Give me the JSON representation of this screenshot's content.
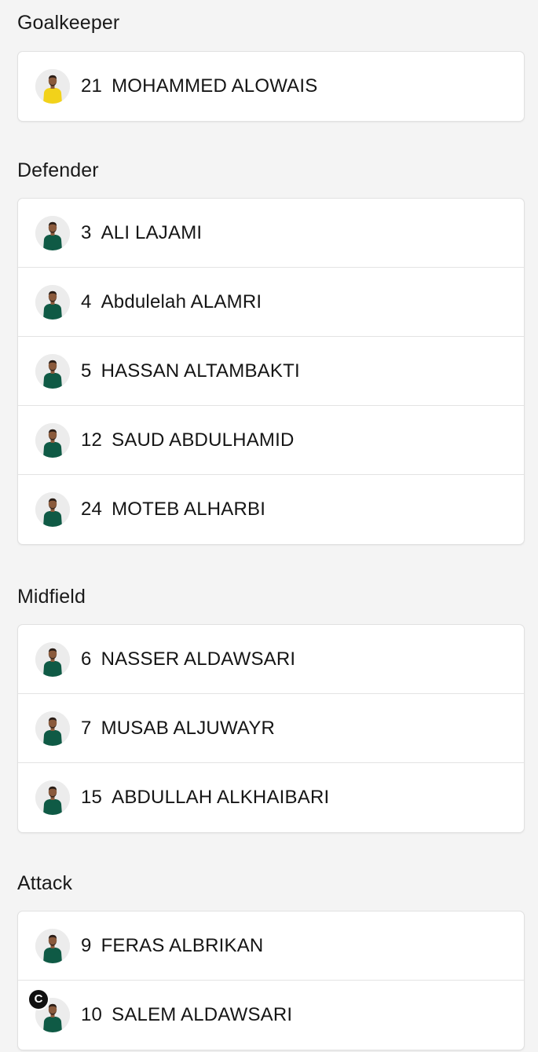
{
  "sections": [
    {
      "title": "Goalkeeper",
      "players": [
        {
          "number": "21",
          "name": "MOHAMMED ALOWAIS",
          "kit": "gk"
        }
      ]
    },
    {
      "title": "Defender",
      "players": [
        {
          "number": "3",
          "name": "ALI LAJAMI",
          "kit": "outfield"
        },
        {
          "number": "4",
          "name": "Abdulelah ALAMRI",
          "kit": "outfield"
        },
        {
          "number": "5",
          "name": "HASSAN ALTAMBAKTI",
          "kit": "outfield"
        },
        {
          "number": "12",
          "name": "SAUD ABDULHAMID",
          "kit": "outfield"
        },
        {
          "number": "24",
          "name": "MOTEB ALHARBI",
          "kit": "outfield"
        }
      ]
    },
    {
      "title": "Midfield",
      "players": [
        {
          "number": "6",
          "name": "NASSER ALDAWSARI",
          "kit": "outfield"
        },
        {
          "number": "7",
          "name": "MUSAB ALJUWAYR",
          "kit": "outfield"
        },
        {
          "number": "15",
          "name": "ABDULLAH ALKHAIBARI",
          "kit": "outfield"
        }
      ]
    },
    {
      "title": "Attack",
      "players": [
        {
          "number": "9",
          "name": "FERAS ALBRIKAN",
          "kit": "outfield"
        },
        {
          "number": "10",
          "name": "SALEM ALDAWSARI",
          "kit": "outfield",
          "captain": true,
          "badge": "C"
        }
      ]
    }
  ],
  "colors": {
    "background": "#f4f4f4",
    "card": "#ffffff",
    "outfield_kit": "#0f5a45",
    "gk_kit": "#f2d21a",
    "skin": "#8a5a3c",
    "hair": "#2a1d16",
    "captain_badge": "#111111"
  },
  "icons": {
    "avatar": "player-photo-icon",
    "captain": "captain-badge-icon"
  }
}
